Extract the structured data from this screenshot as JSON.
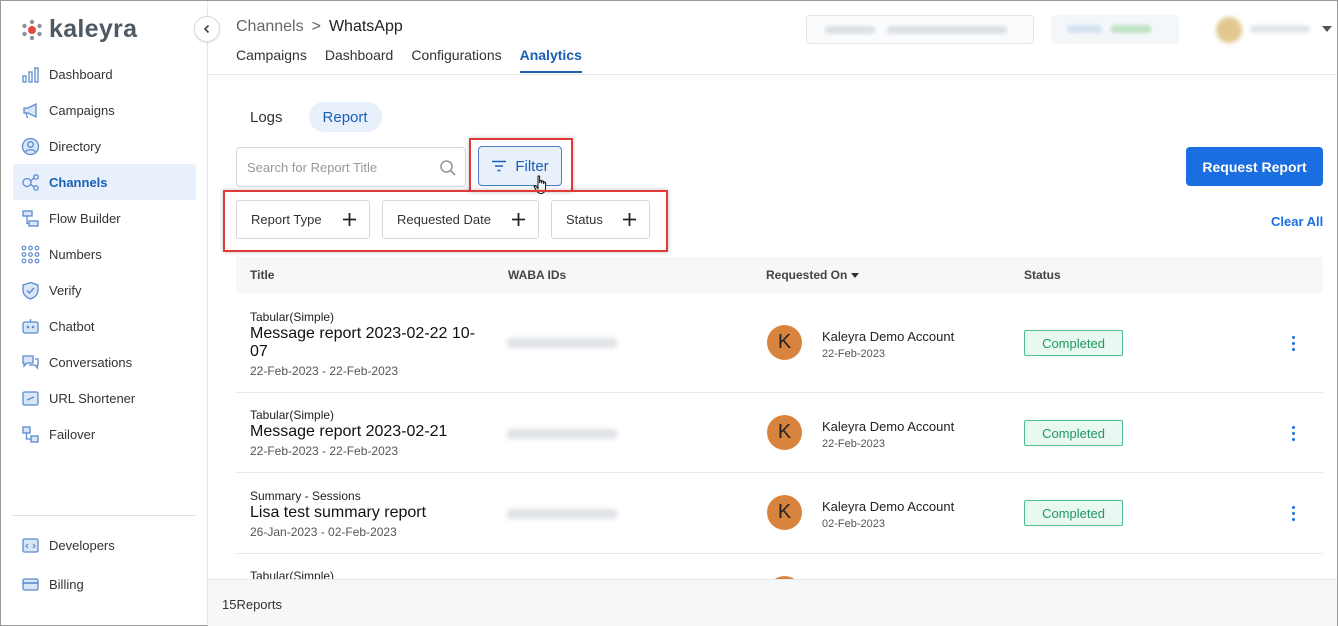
{
  "brand": {
    "name": "kaleyra"
  },
  "sidebar": {
    "items": [
      {
        "label": "Dashboard",
        "icon": "bar-chart-icon"
      },
      {
        "label": "Campaigns",
        "icon": "megaphone-icon"
      },
      {
        "label": "Directory",
        "icon": "user-circle-icon"
      },
      {
        "label": "Channels",
        "icon": "channels-icon",
        "active": true
      },
      {
        "label": "Flow Builder",
        "icon": "flow-icon"
      },
      {
        "label": "Numbers",
        "icon": "dial-grid-icon"
      },
      {
        "label": "Verify",
        "icon": "shield-check-icon"
      },
      {
        "label": "Chatbot",
        "icon": "chatbot-icon"
      },
      {
        "label": "Conversations",
        "icon": "chat-bubbles-icon"
      },
      {
        "label": "URL Shortener",
        "icon": "link-icon"
      },
      {
        "label": "Failover",
        "icon": "failover-icon"
      }
    ],
    "bottom_items": [
      {
        "label": "Developers",
        "icon": "code-icon"
      },
      {
        "label": "Billing",
        "icon": "credit-card-icon"
      }
    ]
  },
  "header": {
    "breadcrumb": {
      "parent": "Channels",
      "separator": ">",
      "current": "WhatsApp"
    },
    "tabs": [
      "Campaigns",
      "Dashboard",
      "Configurations",
      "Analytics"
    ],
    "active_tab": "Analytics"
  },
  "main": {
    "subtabs": [
      "Logs",
      "Report"
    ],
    "active_subtab": "Report",
    "search": {
      "placeholder": "Search for Report Title"
    },
    "filter_label": "Filter",
    "request_report_label": "Request Report",
    "chips": [
      "Report Type",
      "Requested Date",
      "Status"
    ],
    "clear_all_label": "Clear All"
  },
  "table": {
    "columns": [
      "Title",
      "WABA IDs",
      "Requested On",
      "Status"
    ],
    "rows": [
      {
        "type": "Tabular(Simple)",
        "title": "Message report 2023-02-22 10-07",
        "dates": "22-Feb-2023 - 22-Feb-2023",
        "avatar": "K",
        "account": "Kaleyra Demo Account",
        "requested_on": "22-Feb-2023",
        "status": "Completed"
      },
      {
        "type": "Tabular(Simple)",
        "title": "Message report 2023-02-21",
        "dates": "22-Feb-2023 - 22-Feb-2023",
        "avatar": "K",
        "account": "Kaleyra Demo Account",
        "requested_on": "22-Feb-2023",
        "status": "Completed"
      },
      {
        "type": "Summary - Sessions",
        "title": "Lisa test summary report",
        "dates": "26-Jan-2023 - 02-Feb-2023",
        "avatar": "K",
        "account": "Kaleyra Demo Account",
        "requested_on": "02-Feb-2023",
        "status": "Completed"
      },
      {
        "type": "Tabular(Simple)"
      }
    ]
  },
  "footer": {
    "count_text": "15Reports"
  },
  "colors": {
    "accent": "#1a6ee0",
    "highlight": "#e23a3a",
    "status_completed": "#1f9960",
    "avatar": "#d9843e"
  }
}
